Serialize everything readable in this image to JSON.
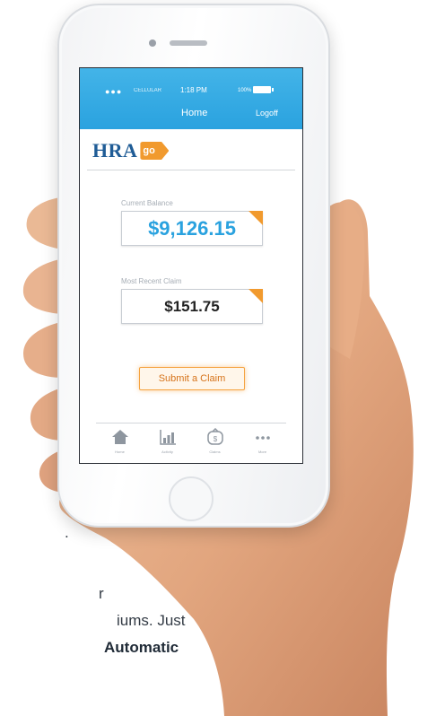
{
  "status_bar": {
    "dots": "●●●",
    "carrier": "CELLULAR",
    "time": "1:18 PM",
    "battery": "100%"
  },
  "nav": {
    "title": "Home",
    "logoff": "Logoff"
  },
  "brand": {
    "name": "HRA",
    "badge": "go",
    "accent_color": "#f19a2e",
    "primary_color": "#1f5c96"
  },
  "balance": {
    "label": "Current Balance",
    "value": "$9,126.15",
    "value_color": "#2aa2df"
  },
  "recent_claim": {
    "label": "Most Recent Claim",
    "value": "$151.75"
  },
  "submit_button": {
    "label": "Submit a Claim"
  },
  "tabs": [
    {
      "label": "Home",
      "icon": "home-icon"
    },
    {
      "label": "Activity",
      "icon": "chart-icon"
    },
    {
      "label": "Claims",
      "icon": "money-bag-icon"
    },
    {
      "label": "More",
      "icon": "more-icon"
    }
  ],
  "caption": {
    "line1": ".",
    "line2": "r",
    "line3": "iums. Just",
    "line4": "Automatic"
  }
}
